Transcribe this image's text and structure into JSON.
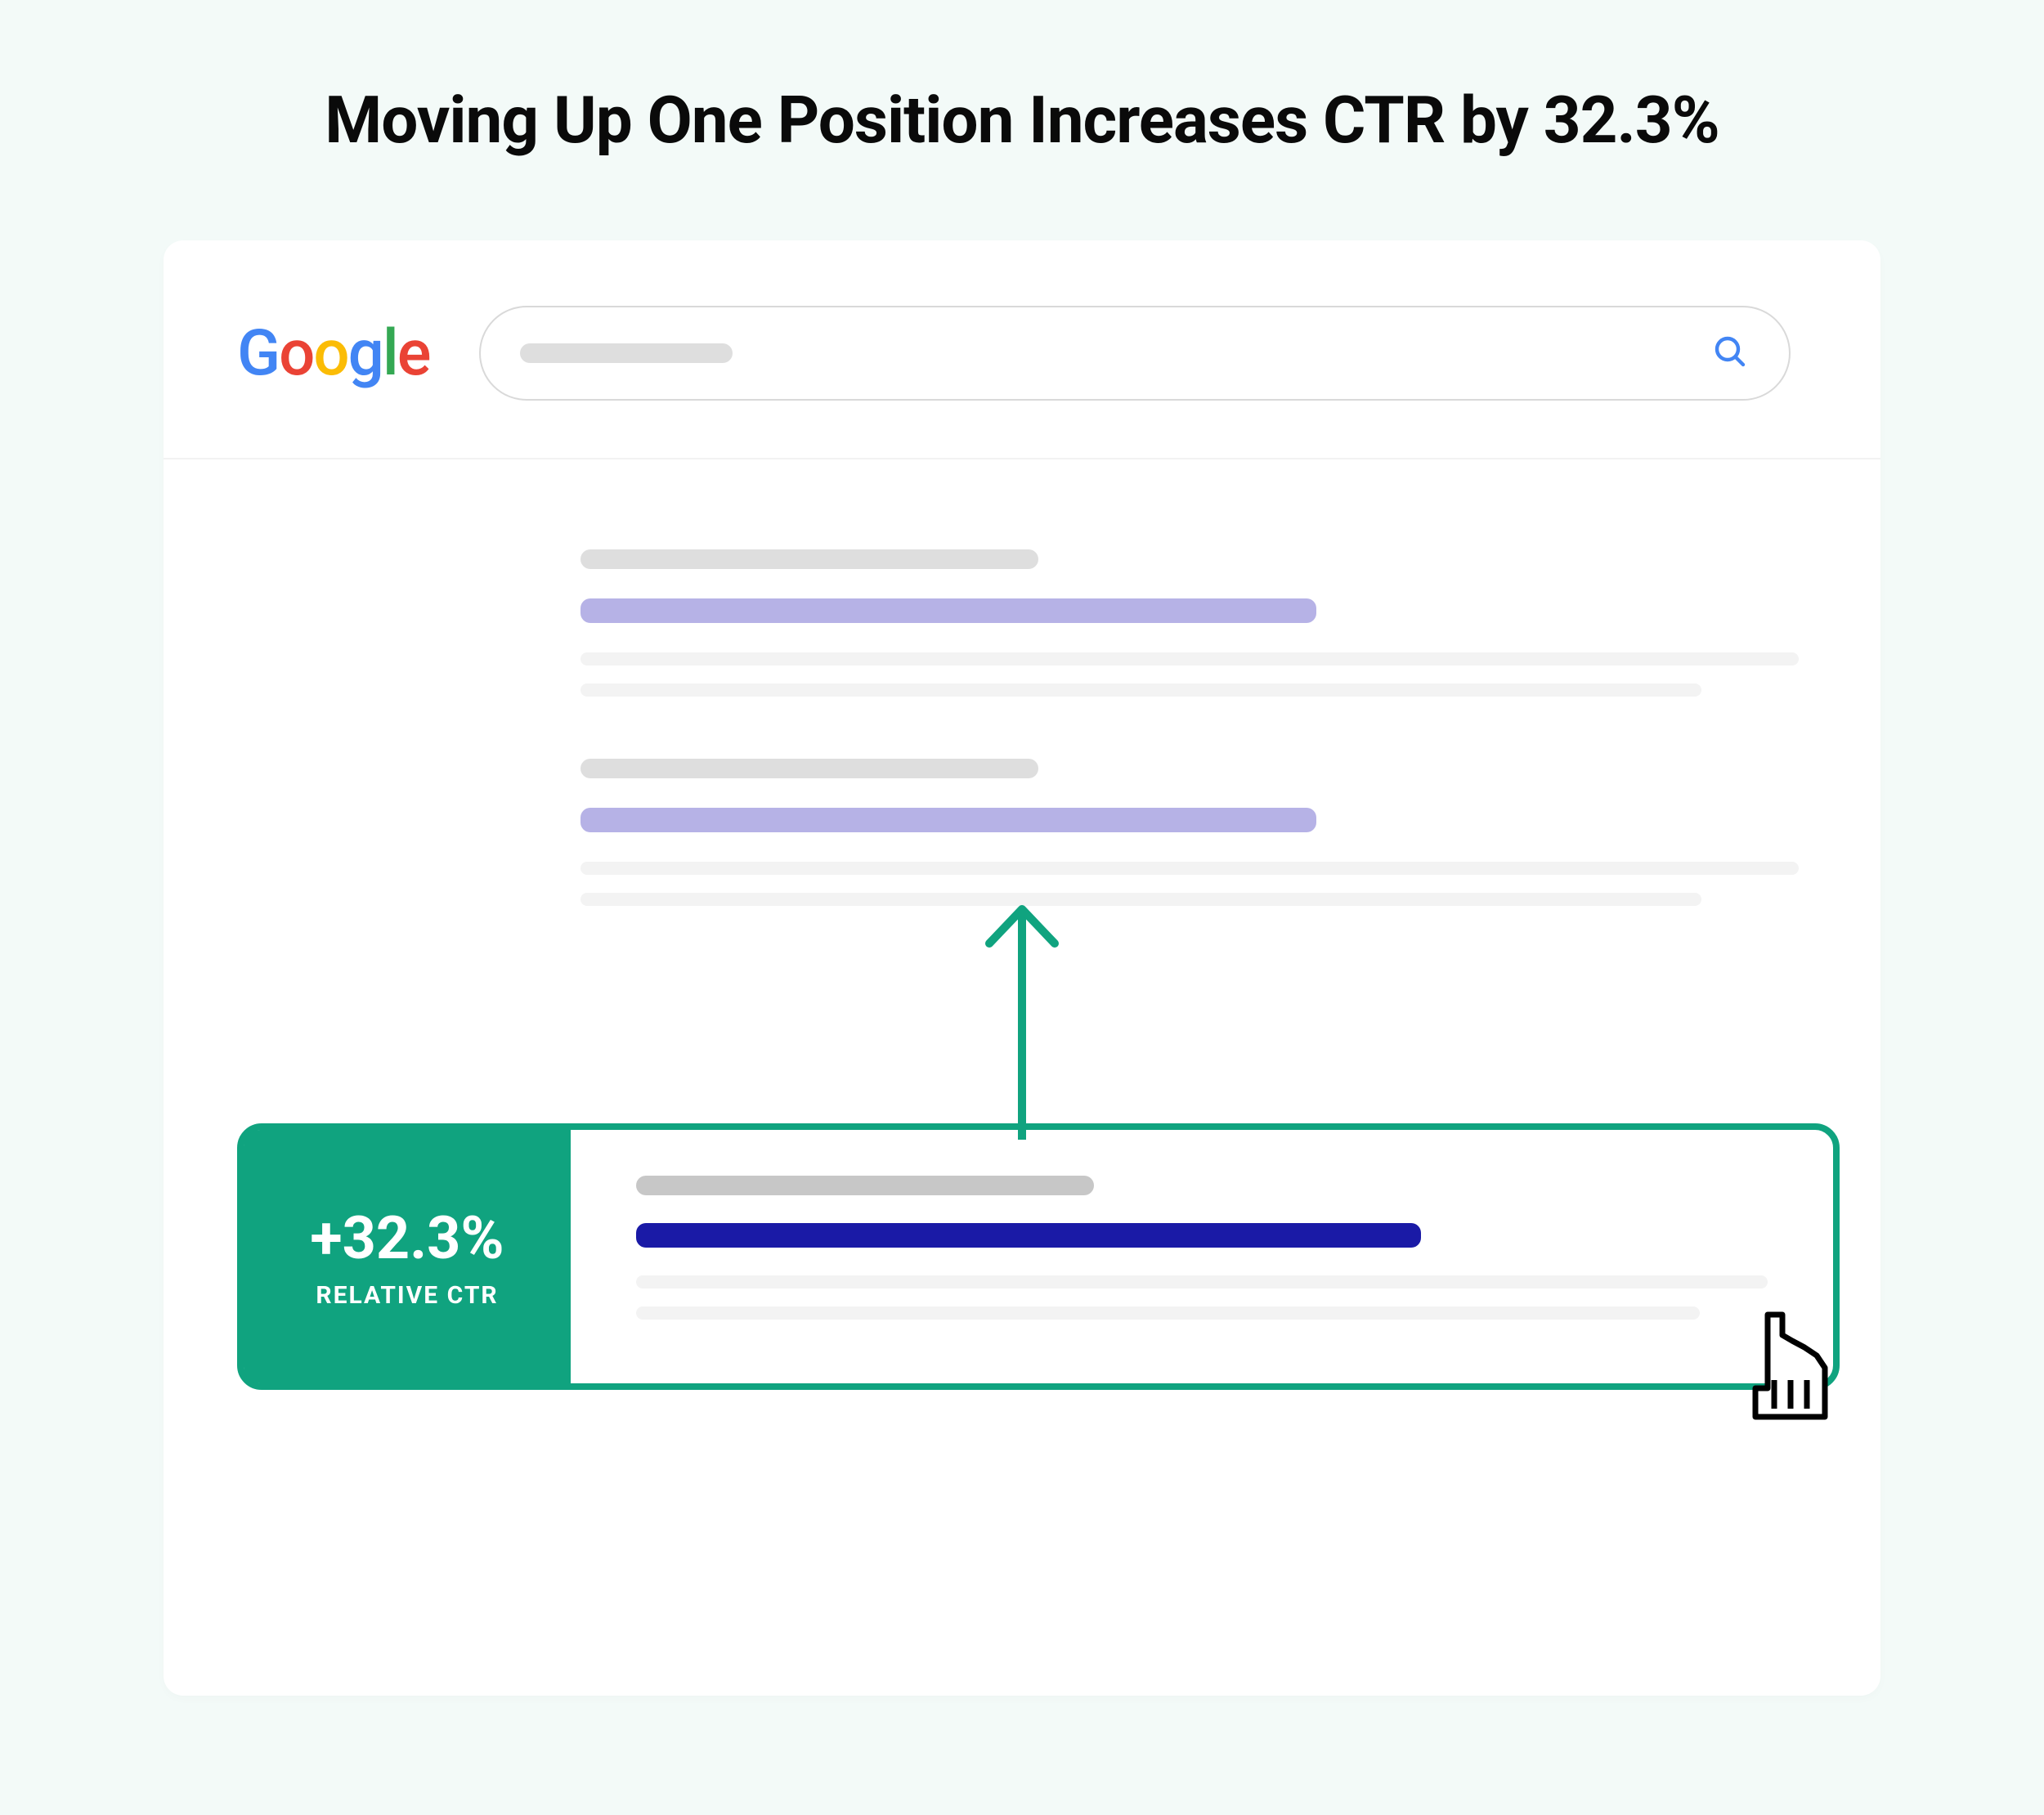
{
  "title": "Moving Up One Position Increases CTR by 32.3%",
  "logo": {
    "g1": "G",
    "g2": "o",
    "g3": "o",
    "g4": "g",
    "g5": "l",
    "g6": "e"
  },
  "highlight": {
    "percentage": "+32.3%",
    "label": "RELATIVE CTR"
  },
  "chart_data": {
    "type": "table",
    "title": "Moving Up One Position Increases CTR by 32.3%",
    "metric": "Relative CTR increase from moving up one SERP position",
    "values": [
      {
        "label": "Relative CTR gain",
        "value": 32.3,
        "unit": "percent"
      }
    ]
  }
}
